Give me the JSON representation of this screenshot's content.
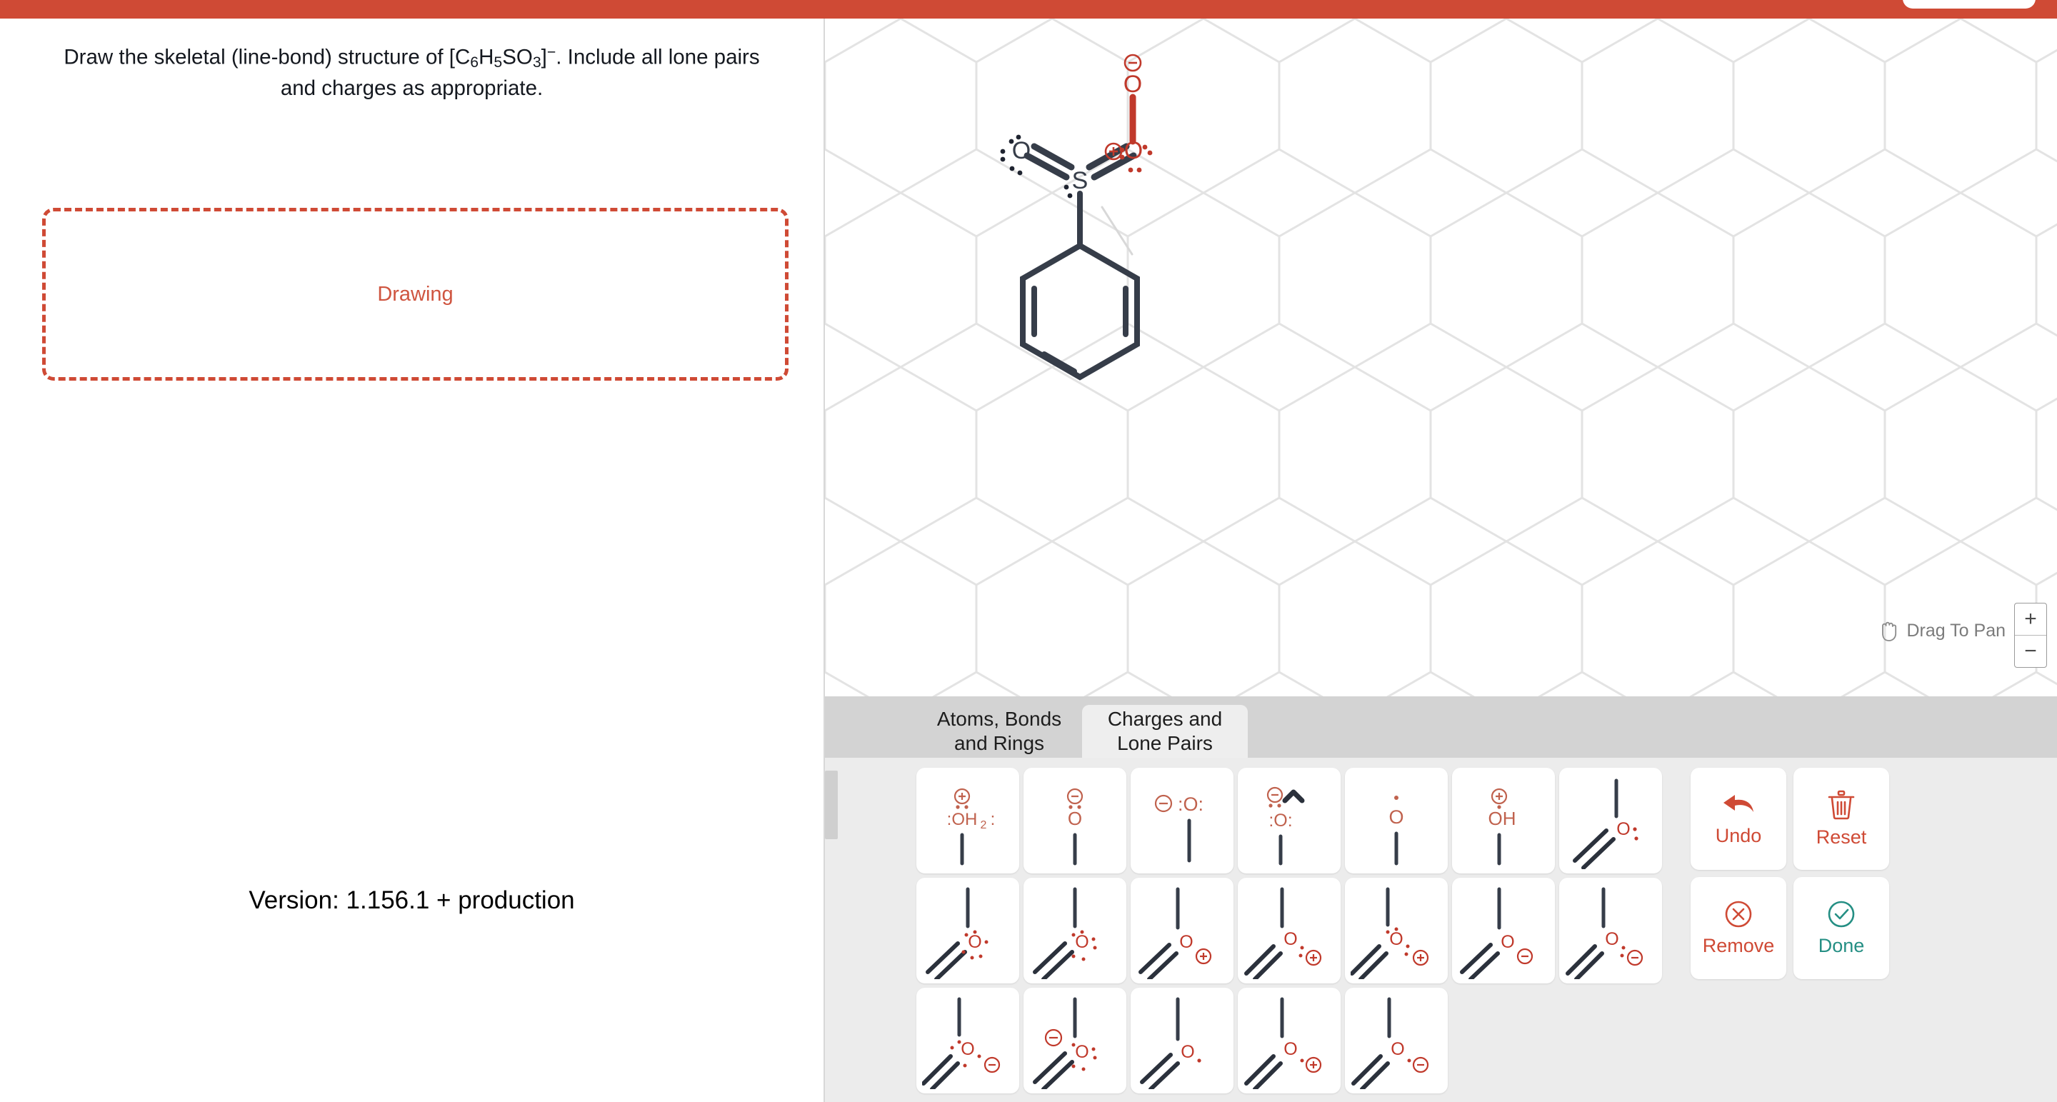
{
  "theme": {
    "brand_red": "#cf4a35",
    "accent_red": "#c0392b",
    "bond_dark": "#363d49",
    "teal": "#258f84",
    "grid_gray": "#e2e2e2"
  },
  "prompt": {
    "line1_a": "Draw the skeletal (line-bond) structure of [C",
    "formula_sub1": "6",
    "line1_b": "H",
    "formula_sub2": "5",
    "line1_c": "SO",
    "formula_sub3": "3",
    "line1_d": "]",
    "charge_sup": "−",
    "line1_e": ". Include all lone pairs and charges as appropriate.",
    "full_text": "Draw the skeletal (line-bond) structure of [C6H5SO3]−. Include all lone pairs and charges as appropriate."
  },
  "dropzone": {
    "label": "Drawing"
  },
  "version": {
    "text": "Version: 1.156.1 +  production"
  },
  "canvas": {
    "pan_hint": "Drag To Pan",
    "zoom_in": "+",
    "zoom_out": "−",
    "molecule": {
      "name": "benzenesulfonate-partial",
      "atoms": [
        {
          "label": "O",
          "role": "double-bonded-oxygen-left",
          "color": "#363d49",
          "charge": "",
          "lone_pairs": 3
        },
        {
          "label": "S",
          "role": "central-sulfur",
          "color": "#363d49",
          "charge": "",
          "lone_pairs": 1
        },
        {
          "label": "O",
          "role": "double-bonded-oxygen-right",
          "color": "#c0392b",
          "charge": "+",
          "lone_pairs": 2
        },
        {
          "label": "O",
          "role": "terminal-oxygen-top",
          "color": "#c0392b",
          "charge": "−",
          "lone_pairs": 0
        }
      ],
      "ring": "benzene",
      "bonds": [
        {
          "from": "O-left",
          "to": "S",
          "order": 2,
          "color": "#363d49"
        },
        {
          "from": "S",
          "to": "O-right",
          "order": 2,
          "color": "#c0392b"
        },
        {
          "from": "O-right",
          "to": "O-top",
          "order": 1,
          "color": "#c0392b"
        },
        {
          "from": "S",
          "to": "ring",
          "order": 1,
          "color": "#363d49"
        }
      ]
    }
  },
  "tabs": [
    {
      "id": "atoms-bonds-rings",
      "line1": "Atoms, Bonds",
      "line2": "and Rings",
      "active": false
    },
    {
      "id": "charges-lone-pairs",
      "line1": "Charges and",
      "line2": "Lone Pairs",
      "active": true
    }
  ],
  "palette": {
    "rows": [
      [
        {
          "id": "oh2-plus",
          "kind": "vertical",
          "label": ":OH₂:",
          "charge": "+",
          "dots": "both-sides",
          "sub": "2"
        },
        {
          "id": "o-minus-dots",
          "kind": "vertical",
          "label": "O",
          "charge": "−",
          "dots": "below",
          "sub": ""
        },
        {
          "id": "o-minus-inline",
          "kind": "vertical",
          "label": ":O:",
          "charge": "−",
          "dots": "inline-left",
          "sub": ""
        },
        {
          "id": "o-minus-wedge",
          "kind": "vertical",
          "label": ":O:",
          "charge": "−",
          "dots": "wedge",
          "sub": ""
        },
        {
          "id": "o-radical",
          "kind": "vertical",
          "label": "O",
          "charge": "",
          "dots": "one-above",
          "sub": ""
        },
        {
          "id": "oh-plus",
          "kind": "vertical",
          "label": "OH",
          "charge": "+",
          "dots": "none",
          "sub": ""
        },
        {
          "id": "double-o-dots-1",
          "kind": "branch",
          "label": "O",
          "charge": "",
          "dots": "right",
          "sub": ""
        }
      ],
      [
        {
          "id": "branch-o-dots-a",
          "kind": "branch",
          "label": "O",
          "charge": "",
          "dots": "full"
        },
        {
          "id": "branch-o-dots-b",
          "kind": "branch",
          "label": "O",
          "charge": "",
          "dots": "full2"
        },
        {
          "id": "branch-o-plus-a",
          "kind": "branch",
          "label": "O",
          "charge": "+",
          "dots": "none"
        },
        {
          "id": "branch-o-plus-b",
          "kind": "branch",
          "label": "O",
          "charge": "+",
          "dots": "right"
        },
        {
          "id": "branch-o-plus-c",
          "kind": "branch",
          "label": "O",
          "charge": "+",
          "dots": "full"
        },
        {
          "id": "branch-o-minus-a",
          "kind": "branch",
          "label": "O",
          "charge": "−",
          "dots": "none"
        },
        {
          "id": "branch-o-minus-b",
          "kind": "branch",
          "label": "O",
          "charge": "−",
          "dots": "right"
        }
      ],
      [
        {
          "id": "branch-o-minus-c",
          "kind": "branch",
          "label": "O",
          "charge": "−",
          "dots": "full"
        },
        {
          "id": "branch-o-minus-d",
          "kind": "branch",
          "label": "O",
          "charge": "−",
          "dots": "full-left"
        },
        {
          "id": "branch-o-plain",
          "kind": "branch",
          "label": "O",
          "charge": "",
          "dots": "one-right"
        },
        {
          "id": "branch-o-plus-d",
          "kind": "branch",
          "label": "O",
          "charge": "+",
          "dots": "one-right"
        },
        {
          "id": "branch-o-minus-e",
          "kind": "branch",
          "label": "O",
          "charge": "−",
          "dots": "one-right"
        }
      ]
    ]
  },
  "actions": [
    {
      "id": "undo",
      "label": "Undo",
      "icon": "undo-arrow-icon",
      "tone": "red"
    },
    {
      "id": "reset",
      "label": "Reset",
      "icon": "trash-icon",
      "tone": "red"
    },
    {
      "id": "remove",
      "label": "Remove",
      "icon": "circle-x-icon",
      "tone": "red"
    },
    {
      "id": "done",
      "label": "Done",
      "icon": "circle-check-icon",
      "tone": "teal"
    }
  ]
}
